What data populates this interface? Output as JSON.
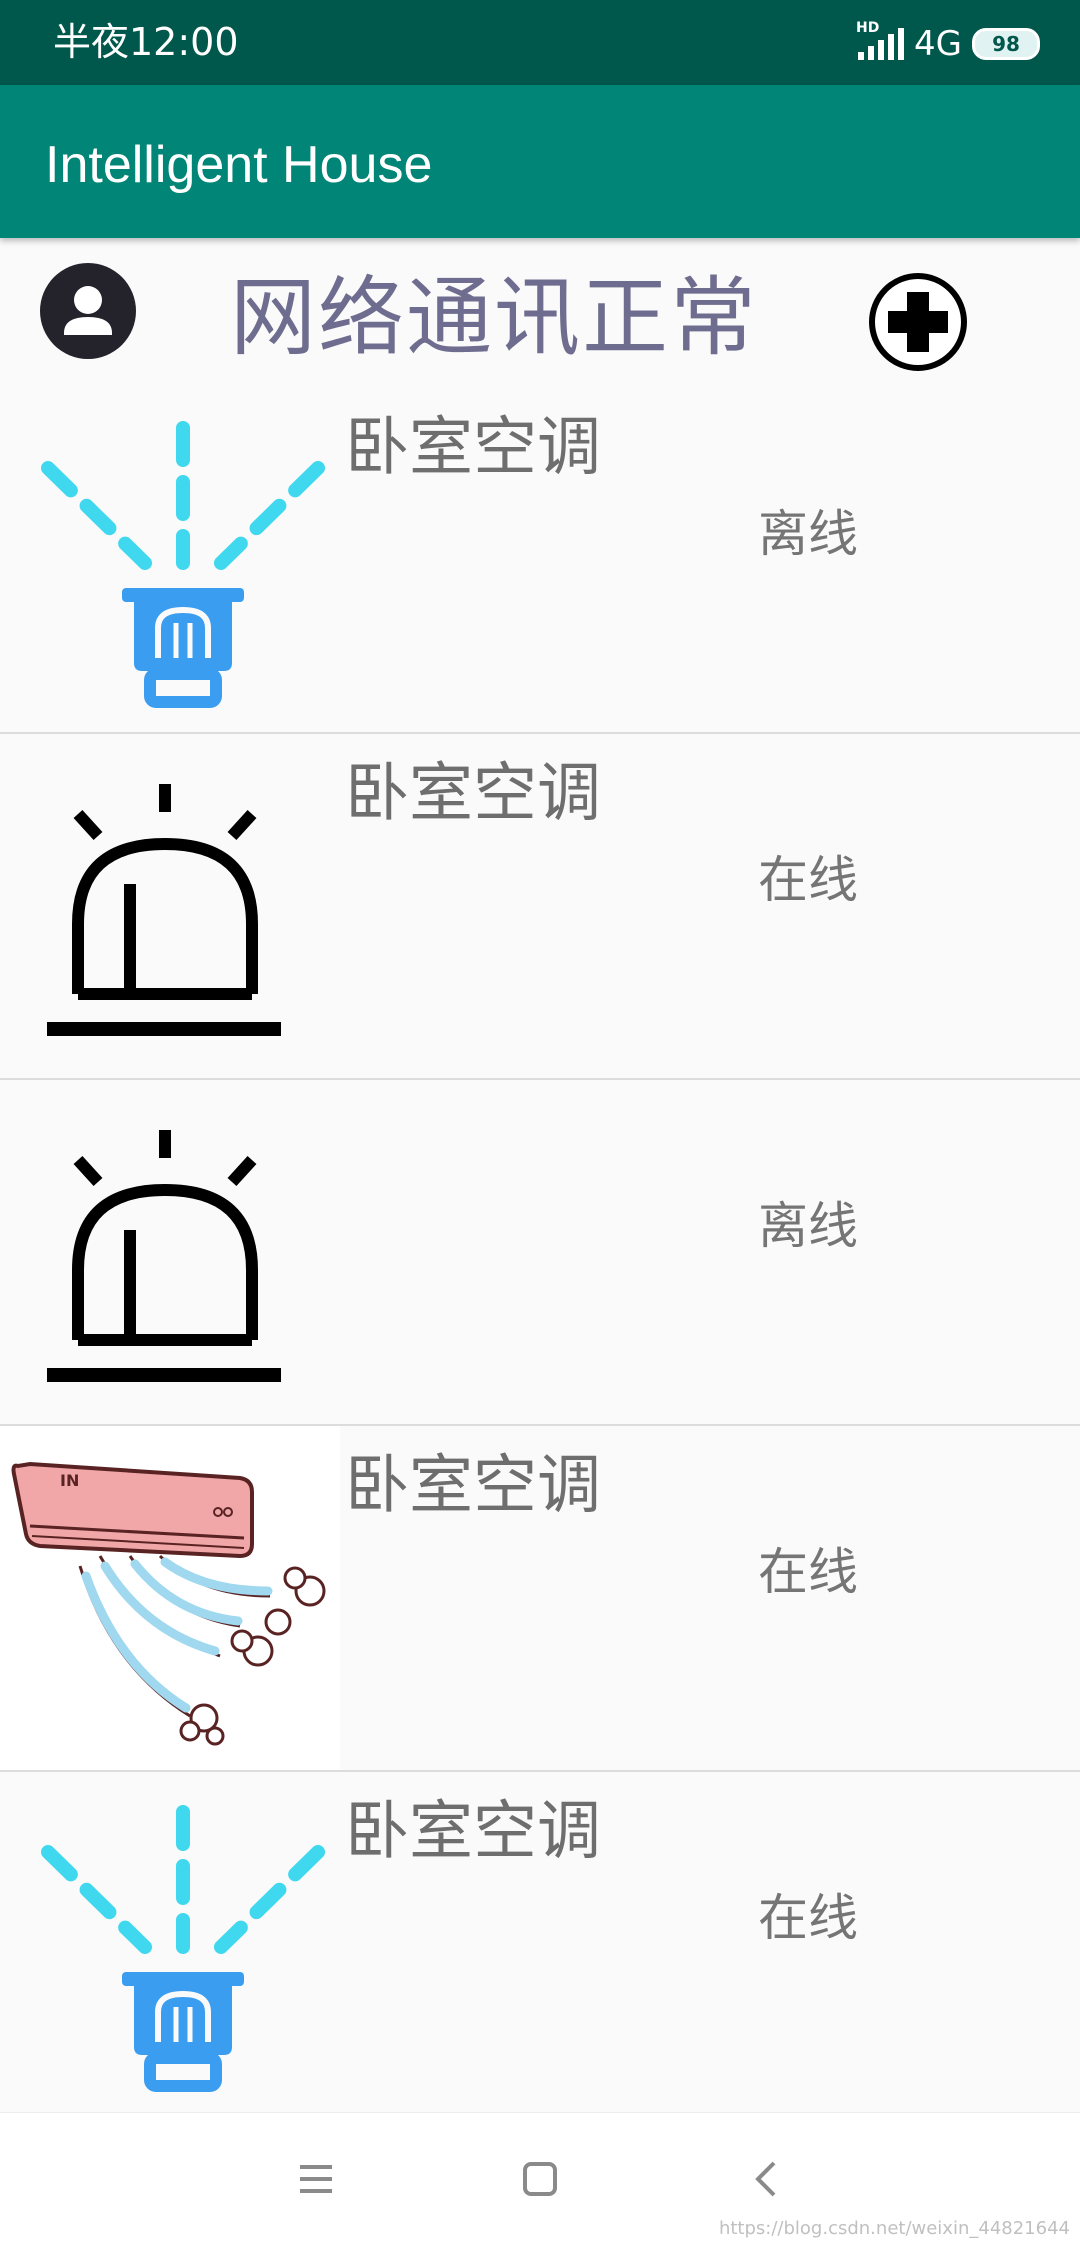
{
  "status_bar": {
    "time": "半夜12:00",
    "signal_badge": "HD",
    "network": "4G",
    "battery": "98"
  },
  "app_bar": {
    "title": "Intelligent House"
  },
  "header": {
    "network_status": "网络通讯正常",
    "avatar_icon": "user-avatar-icon",
    "add_icon": "add-circle-icon"
  },
  "devices": [
    {
      "icon": "sprinkler-icon",
      "name": "卧室空调",
      "status": "离线"
    },
    {
      "icon": "alarm-light-icon",
      "name": "卧室空调",
      "status": "在线"
    },
    {
      "icon": "alarm-light-icon",
      "name": "",
      "status": "离线"
    },
    {
      "icon": "air-conditioner-icon",
      "name": "卧室空调",
      "status": "在线"
    },
    {
      "icon": "sprinkler-icon",
      "name": "卧室空调",
      "status": "在线"
    }
  ],
  "nav_bar": {
    "menu_icon": "menu-icon",
    "home_icon": "home-icon",
    "back_icon": "back-icon"
  },
  "watermark": "https://blog.csdn.net/weixin_44821644",
  "colors": {
    "status_bar": "#00574b",
    "app_bar": "#008577",
    "network_status_text": "#6f6d8f",
    "sprinkler_spray": "#3fd8ee",
    "sprinkler_body": "#3a9df0"
  }
}
